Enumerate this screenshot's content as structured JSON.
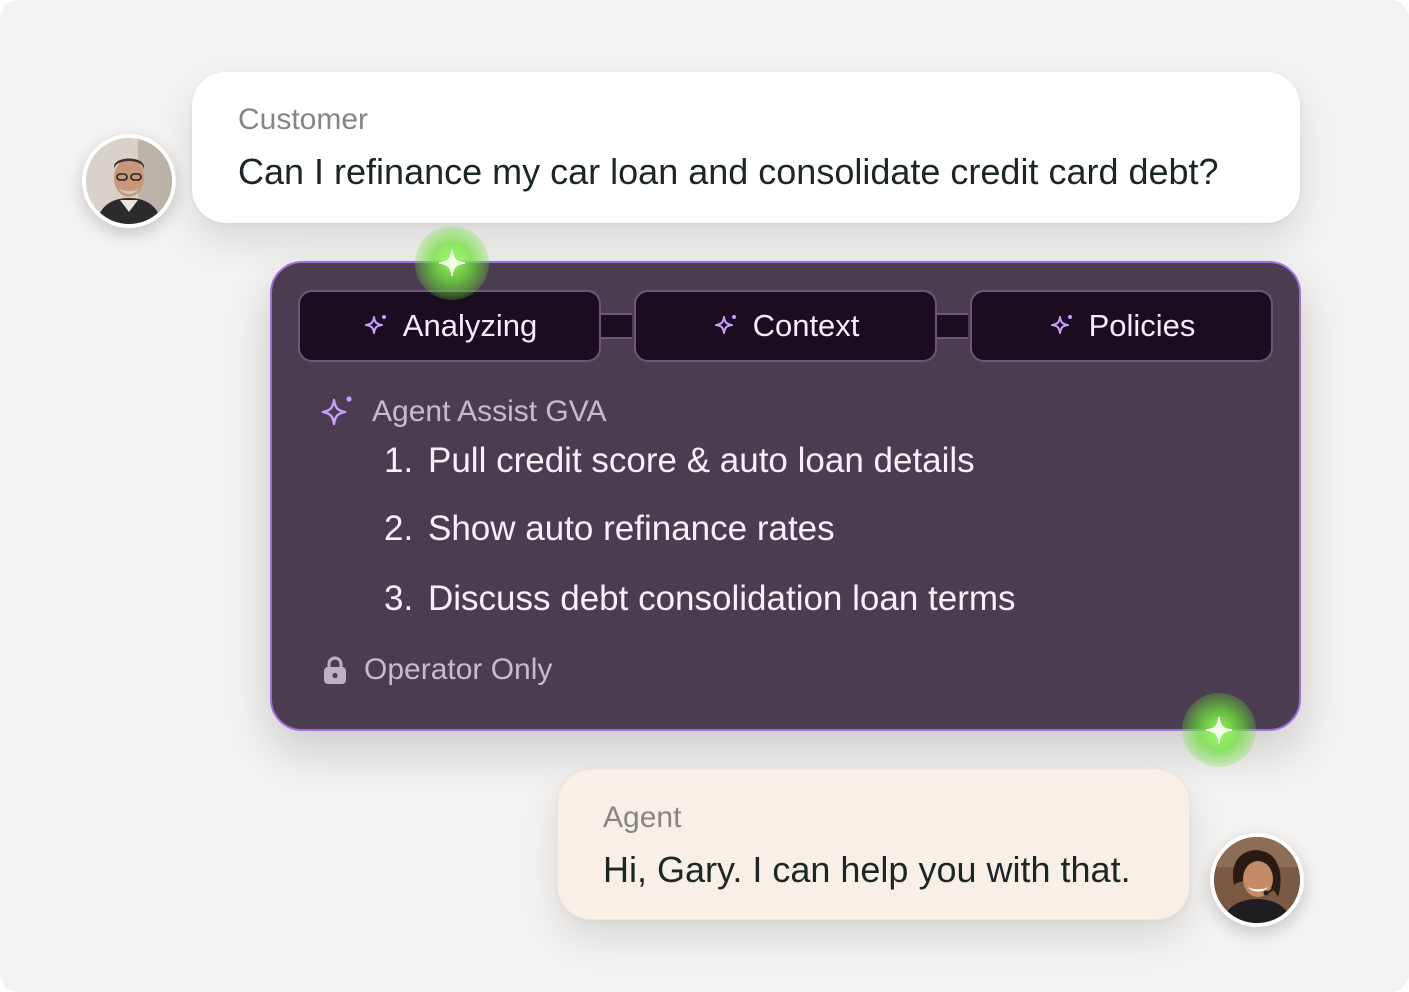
{
  "customer": {
    "label": "Customer",
    "message": "Can I refinance my car loan and consolidate credit card debt?"
  },
  "assist": {
    "tabs": [
      {
        "label": "Analyzing",
        "icon": "sparkle-icon"
      },
      {
        "label": "Context",
        "icon": "sparkle-icon"
      },
      {
        "label": "Policies",
        "icon": "sparkle-icon"
      }
    ],
    "title": "Agent Assist GVA",
    "steps": [
      {
        "num": "1.",
        "text": "Pull credit score & auto loan details"
      },
      {
        "num": "2.",
        "text": "Show auto refinance rates"
      },
      {
        "num": "3.",
        "text": "Discuss debt consolidation loan terms"
      }
    ],
    "footer": {
      "label": "Operator Only",
      "icon": "lock-icon"
    }
  },
  "agent": {
    "label": "Agent",
    "message": "Hi, Gary. I can help you with that."
  },
  "colors": {
    "background": "#f3f2f0",
    "panel": "#4b3d50",
    "panel_border": "#9e6ee0",
    "chip": "#1b0d20",
    "accent_purple": "#c9a0ff",
    "glow_green": "#8cf05a",
    "agent_bubble": "#f8efe6"
  }
}
